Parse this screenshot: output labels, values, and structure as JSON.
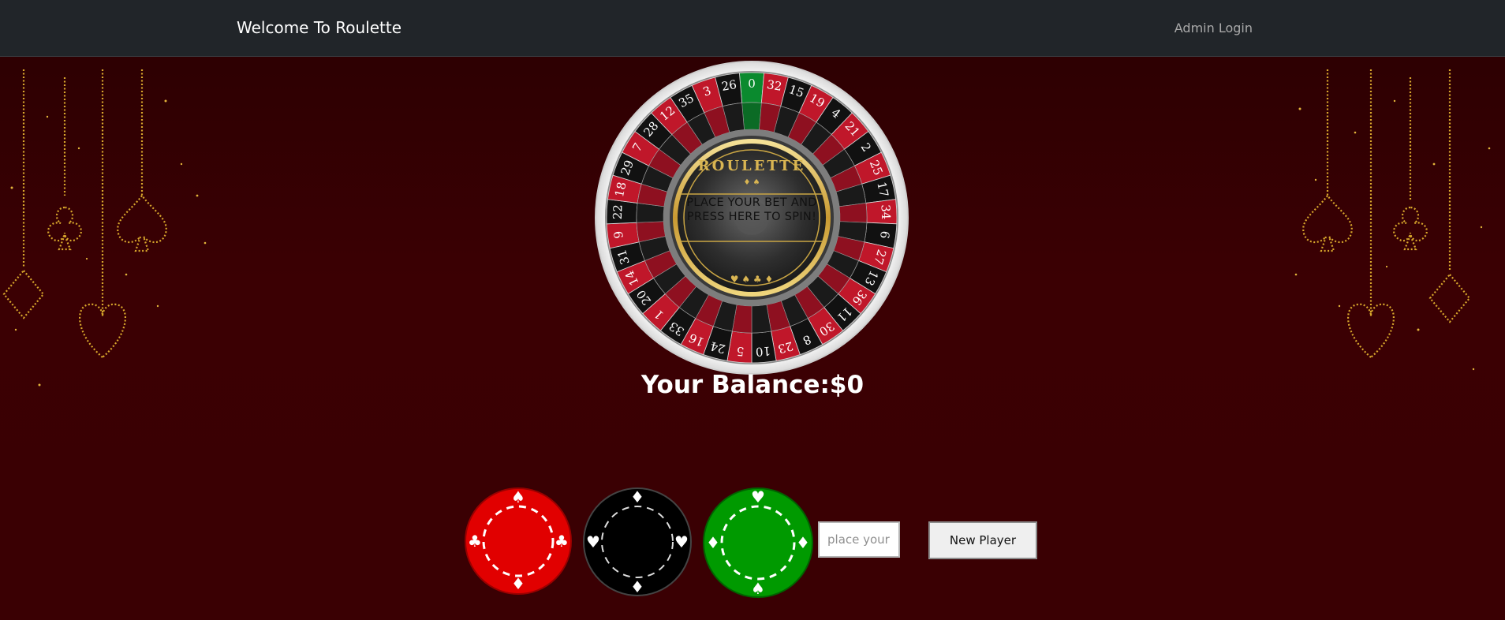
{
  "navbar": {
    "brand": "Welcome To Roulette",
    "admin_login": "Admin Login"
  },
  "wheel": {
    "title": "ROULETTE",
    "spin_instruction": "PLACE YOUR BET AND PRESS HERE TO SPIN!",
    "numbers": [
      "0",
      "32",
      "15",
      "19",
      "4",
      "21",
      "2",
      "25",
      "17",
      "34",
      "6",
      "27",
      "13",
      "36",
      "11",
      "30",
      "8",
      "23",
      "10",
      "5",
      "24",
      "16",
      "33",
      "1",
      "20",
      "14",
      "31",
      "9",
      "22",
      "18",
      "29",
      "7",
      "28",
      "12",
      "35",
      "3",
      "26"
    ],
    "red_numbers": [
      "1",
      "3",
      "5",
      "7",
      "9",
      "12",
      "14",
      "16",
      "18",
      "19",
      "21",
      "23",
      "25",
      "27",
      "30",
      "32",
      "34",
      "36"
    ],
    "colors": {
      "red": "#c0172a",
      "black": "#111111",
      "green": "#0a8a2e",
      "gold": "#d4b250"
    }
  },
  "balance": {
    "text": "Your Balance:$0"
  },
  "chips": [
    {
      "name": "red-chip",
      "color": "#e10000"
    },
    {
      "name": "black-chip",
      "color": "#000000"
    },
    {
      "name": "green-chip",
      "color": "#009a00"
    }
  ],
  "bet": {
    "placeholder": "place your bet",
    "new_player_label": "New Player"
  }
}
